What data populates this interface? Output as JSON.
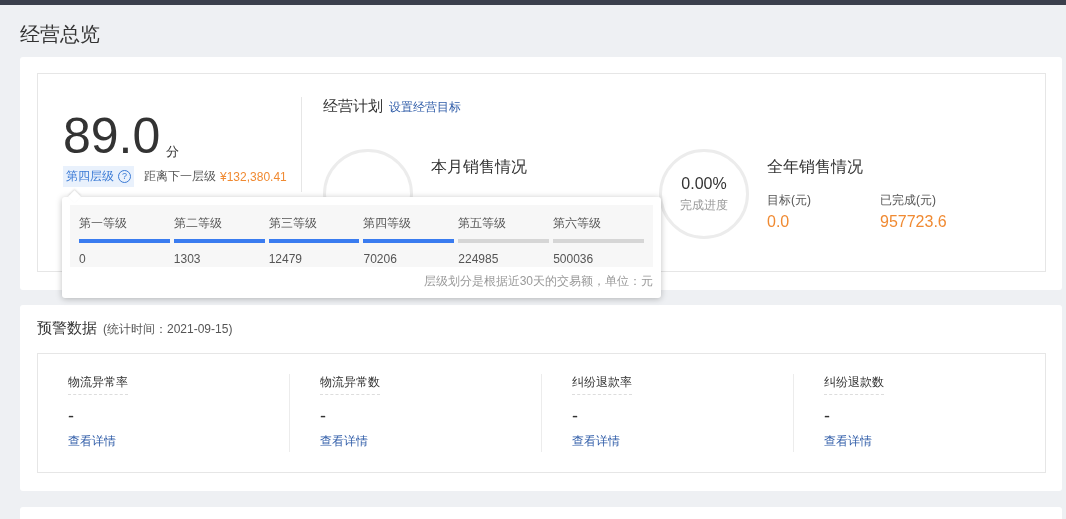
{
  "page_title": "经营总览",
  "score": {
    "value": "89.0",
    "unit": "分",
    "tier": "第四层级",
    "help": "?",
    "next_label": "距离下一层级",
    "next_amount": "¥132,380.41"
  },
  "tier_popup": {
    "tiers": [
      {
        "name": "第一等级",
        "threshold": "0",
        "reached": true
      },
      {
        "name": "第二等级",
        "threshold": "1303",
        "reached": true
      },
      {
        "name": "第三等级",
        "threshold": "12479",
        "reached": true
      },
      {
        "name": "第四等级",
        "threshold": "70206",
        "reached": true
      },
      {
        "name": "第五等级",
        "threshold": "224985",
        "reached": false
      },
      {
        "name": "第六等级",
        "threshold": "500036",
        "reached": false
      }
    ],
    "note": "层级划分是根据近30天的交易额，单位：元"
  },
  "plan": {
    "title": "经营计划",
    "link": "设置经营目标",
    "items": [
      {
        "title": "本月销售情况"
      },
      {
        "progress": "0.00%",
        "progress_label": "完成进度",
        "title": "全年销售情况",
        "target_label": "目标(元)",
        "target_value": "0.0",
        "done_label": "已完成(元)",
        "done_value": "957723.6"
      }
    ]
  },
  "warnings": {
    "title": "预警数据",
    "subtitle": "(统计时间：2021-09-15)",
    "metrics": [
      {
        "label": "物流异常率",
        "value": "-",
        "link": "查看详情"
      },
      {
        "label": "物流异常数",
        "value": "-",
        "link": "查看详情"
      },
      {
        "label": "纠纷退款率",
        "value": "-",
        "link": "查看详情"
      },
      {
        "label": "纠纷退款数",
        "value": "-",
        "link": "查看详情"
      }
    ]
  }
}
